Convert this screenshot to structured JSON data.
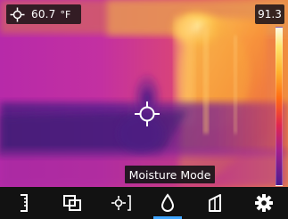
{
  "readout": {
    "temperature": "60.7",
    "unit": "°F",
    "max_value": "91.3"
  },
  "mode": {
    "label": "Moisture Mode"
  },
  "toolbar": {
    "active": "moisture",
    "buttons": [
      {
        "name": "emissivity-icon"
      },
      {
        "name": "gallery-icon"
      },
      {
        "name": "spot-meter-icon"
      },
      {
        "name": "moisture-drop-icon"
      },
      {
        "name": "palette-icon"
      },
      {
        "name": "settings-gear-icon"
      }
    ]
  },
  "colors": {
    "toolbar_bg": "#121212",
    "active_indicator": "#3fa5ff",
    "badge_bg": "#1e1419"
  }
}
